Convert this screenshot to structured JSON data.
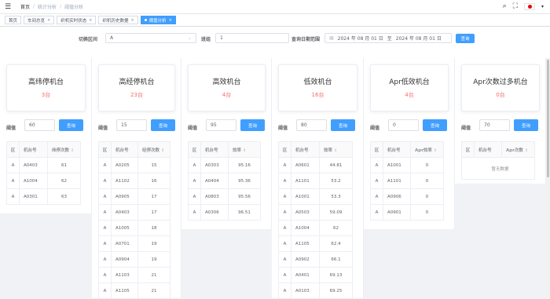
{
  "breadcrumb": [
    "首页",
    "统计分析",
    "阈值分析"
  ],
  "tabs": [
    {
      "label": "首页",
      "active": false,
      "closable": false
    },
    {
      "label": "车间总览",
      "active": false,
      "closable": true
    },
    {
      "label": "织机实时状态",
      "active": false,
      "closable": true
    },
    {
      "label": "织机历史数据",
      "active": false,
      "closable": true
    },
    {
      "label": "阈值分析",
      "active": true,
      "closable": true
    }
  ],
  "filters": {
    "area_label": "切换区间",
    "area_value": "A",
    "group_label": "班组",
    "group_value": "1",
    "date_label": "查询日期范围",
    "date_start": "2024 年 08 月 01 日",
    "date_sep": "至",
    "date_end": "2024 年 08 月 01 日",
    "query_label": "查询"
  },
  "panels": [
    {
      "title": "高纬停机台",
      "count": "3台",
      "threshold_label": "阈值",
      "threshold": "60",
      "query_label": "查询",
      "headers": [
        "区",
        "机台号",
        "纬停次数"
      ],
      "rows": [
        [
          "A",
          "A0403",
          "61"
        ],
        [
          "A",
          "A1004",
          "62"
        ],
        [
          "A",
          "A0301",
          "63"
        ]
      ]
    },
    {
      "title": "高经停机台",
      "count": "23台",
      "threshold_label": "阈值",
      "threshold": "15",
      "query_label": "查询",
      "headers": [
        "区",
        "机台号",
        "经停次数"
      ],
      "rows": [
        [
          "A",
          "A0205",
          "15"
        ],
        [
          "A",
          "A1102",
          "16"
        ],
        [
          "A",
          "A0905",
          "17"
        ],
        [
          "A",
          "A0403",
          "17"
        ],
        [
          "A",
          "A1005",
          "18"
        ],
        [
          "A",
          "A0701",
          "19"
        ],
        [
          "A",
          "A0904",
          "19"
        ],
        [
          "A",
          "A1103",
          "21"
        ],
        [
          "A",
          "A1105",
          "21"
        ]
      ]
    },
    {
      "title": "高效机台",
      "count": "4台",
      "threshold_label": "阈值",
      "threshold": "95",
      "query_label": "查询",
      "headers": [
        "区",
        "机台号",
        "效率"
      ],
      "rows": [
        [
          "A",
          "A0303",
          "95.16"
        ],
        [
          "A",
          "A0404",
          "95.36"
        ],
        [
          "A",
          "A0803",
          "95.56"
        ],
        [
          "A",
          "A0306",
          "96.51"
        ]
      ]
    },
    {
      "title": "低效机台",
      "count": "16台",
      "threshold_label": "阈值",
      "threshold": "80",
      "query_label": "查询",
      "headers": [
        "区",
        "机台号",
        "效率"
      ],
      "rows": [
        [
          "A",
          "A0601",
          "44.81"
        ],
        [
          "A",
          "A1101",
          "53.2"
        ],
        [
          "A",
          "A1001",
          "53.3"
        ],
        [
          "A",
          "A0503",
          "59.09"
        ],
        [
          "A",
          "A1004",
          "62"
        ],
        [
          "A",
          "A1105",
          "62.4"
        ],
        [
          "A",
          "A0902",
          "66.1"
        ],
        [
          "A",
          "A0401",
          "69.13"
        ],
        [
          "A",
          "A0103",
          "69.25"
        ]
      ]
    },
    {
      "title": "Apr低效机台",
      "count": "4台",
      "threshold_label": "阈值",
      "threshold": "0",
      "query_label": "查询",
      "headers": [
        "区",
        "机台号",
        "Apr效率"
      ],
      "rows": [
        [
          "A",
          "A1001",
          "0"
        ],
        [
          "A",
          "A1101",
          "0"
        ],
        [
          "A",
          "A0906",
          "0"
        ],
        [
          "A",
          "A0901",
          "0"
        ]
      ]
    },
    {
      "title": "Apr次数过多机台",
      "count": "0台",
      "threshold_label": "阈值",
      "threshold": "70",
      "query_label": "查询",
      "headers": [
        "区",
        "机台号",
        "Apr次数"
      ],
      "rows": [],
      "empty_text": "暂无数据"
    }
  ],
  "colors": {
    "primary": "#409eff",
    "count_red": "#f56c6c"
  }
}
